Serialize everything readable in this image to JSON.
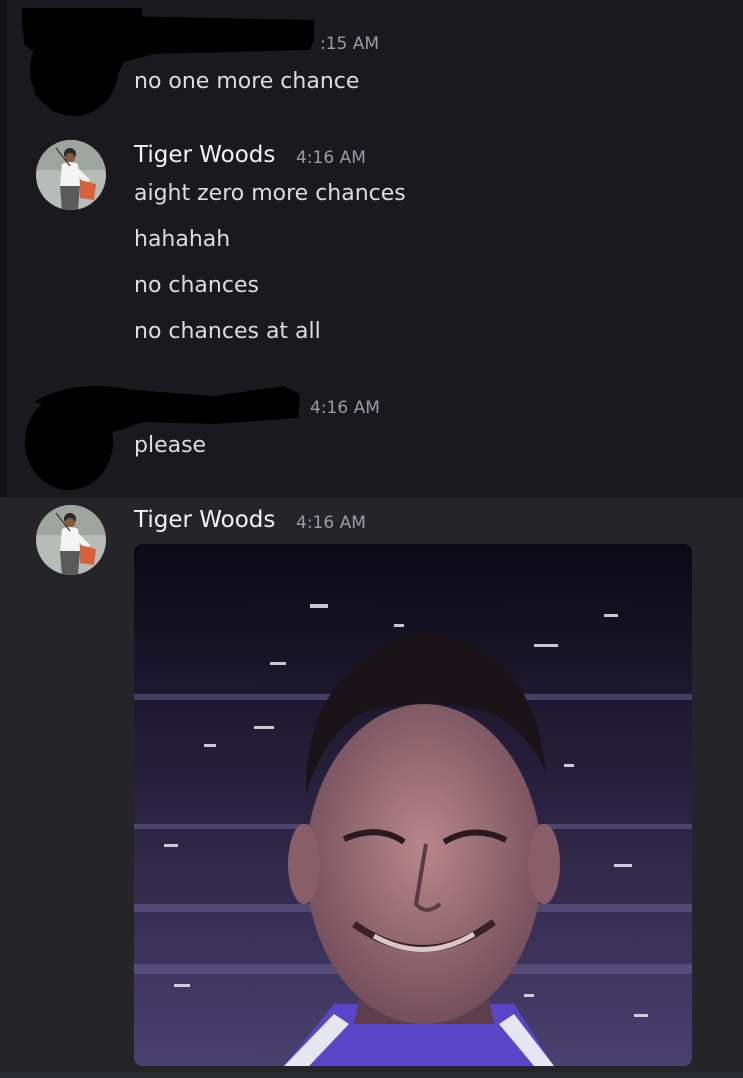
{
  "messages": [
    {
      "author_hidden": true,
      "time": ":15 AM",
      "lines": [
        "no one more chance"
      ]
    },
    {
      "author": "Tiger Woods",
      "time": "4:16 AM",
      "lines": [
        "aight zero more chances",
        "hahahah",
        "no chances",
        "no chances at all"
      ]
    },
    {
      "author_hidden": true,
      "time": "4:16 AM",
      "lines": [
        "please"
      ]
    },
    {
      "author": "Tiger Woods",
      "time": "4:16 AM",
      "attachment": "image"
    }
  ],
  "colors": {
    "background": "#1a1a1e",
    "highlight": "#242429",
    "author": "#f2f3f5",
    "text": "#dbdee1",
    "timestamp": "#9a9ca3"
  },
  "icons": [
    "golfer-avatar-icon"
  ]
}
